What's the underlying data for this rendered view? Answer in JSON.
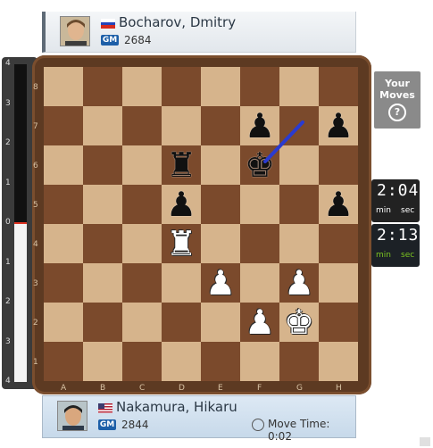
{
  "top_player": {
    "name": "Bocharov, Dmitry",
    "title": "GM",
    "rating": "2684",
    "flag": "russia"
  },
  "bottom_player": {
    "name": "Nakamura, Hikaru",
    "title": "GM",
    "rating": "2844",
    "flag": "usa",
    "move_time_label": "Move Time: 0:02"
  },
  "your_moves": {
    "line1": "Your",
    "line2": "Moves",
    "help": "?"
  },
  "clocks": {
    "top": {
      "time": "2:04",
      "min": "min",
      "sec": "sec"
    },
    "bottom": {
      "time": "2:13",
      "min": "min",
      "sec": "sec"
    }
  },
  "eval_bar": {
    "ticks": [
      "4",
      "3",
      "2",
      "1",
      "0",
      "1",
      "2",
      "3",
      "4"
    ],
    "value": 0
  },
  "board": {
    "files": [
      "A",
      "B",
      "C",
      "D",
      "E",
      "F",
      "G",
      "H"
    ],
    "ranks": [
      "8",
      "7",
      "6",
      "5",
      "4",
      "3",
      "2",
      "1"
    ],
    "pieces": [
      {
        "square": "f7",
        "piece": "pawn",
        "color": "black"
      },
      {
        "square": "h7",
        "piece": "pawn",
        "color": "black"
      },
      {
        "square": "d6",
        "piece": "rook",
        "color": "black"
      },
      {
        "square": "f6",
        "piece": "king",
        "color": "black"
      },
      {
        "square": "d5",
        "piece": "pawn",
        "color": "black"
      },
      {
        "square": "h5",
        "piece": "pawn",
        "color": "black"
      },
      {
        "square": "d4",
        "piece": "rook",
        "color": "white"
      },
      {
        "square": "e3",
        "piece": "pawn",
        "color": "white"
      },
      {
        "square": "g3",
        "piece": "pawn",
        "color": "white"
      },
      {
        "square": "f2",
        "piece": "pawn",
        "color": "white"
      },
      {
        "square": "g2",
        "piece": "king",
        "color": "white"
      }
    ],
    "arrow": {
      "from": "f6",
      "to": "g7",
      "color": "#2a3bd0"
    }
  },
  "colors": {
    "light_square": "#d6b48c",
    "dark_square": "#7b4a2c",
    "frame": "#5d3a22",
    "active_clock_units": "#7cc420"
  }
}
